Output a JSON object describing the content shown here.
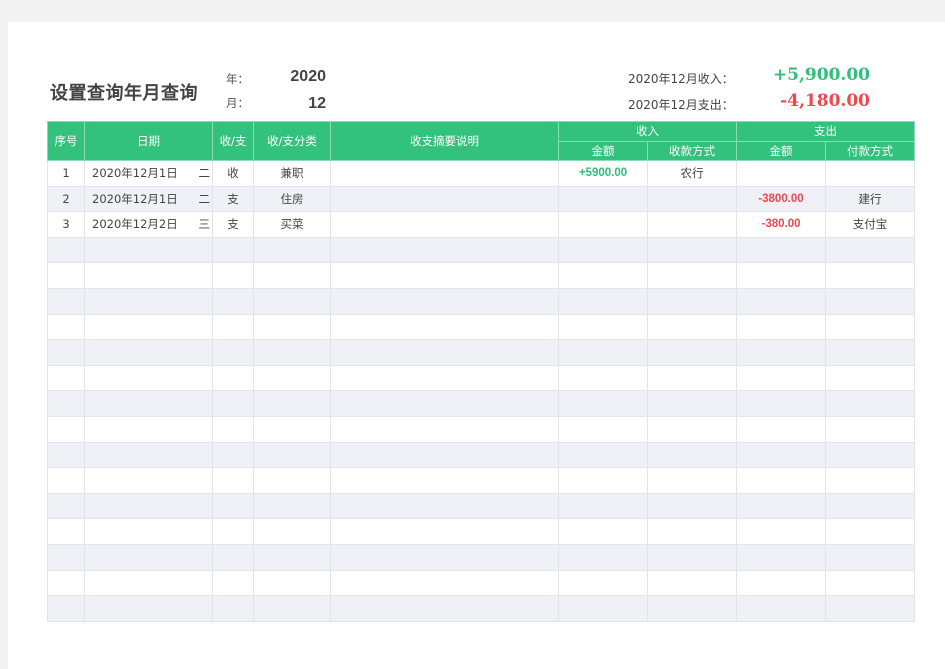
{
  "header": {
    "title": "设置查询年月查询",
    "year_label": "年：",
    "year_value": "2020",
    "month_label": "月：",
    "month_value": "12",
    "income_label": "2020年12月收入：",
    "income_value": "+5,900.00",
    "expense_label": "2020年12月支出：",
    "expense_value": "-4,180.00"
  },
  "colors": {
    "header_green": "#33c17e",
    "income_green": "#2fbf7a",
    "expense_red": "#f0474f"
  },
  "table": {
    "headers": {
      "seq": "序号",
      "date": "日期",
      "type": "收/支",
      "category": "收/支分类",
      "desc": "收支摘要说明",
      "income": "收入",
      "expense": "支出",
      "income_amount": "金额",
      "income_method": "收款方式",
      "expense_amount": "金额",
      "expense_method": "付款方式"
    },
    "rows": [
      {
        "seq": "1",
        "date": "2020年12月1日",
        "weekday": "二",
        "type": "收",
        "category": "兼职",
        "desc": "",
        "income_amount": "+5900.00",
        "income_method": "农行",
        "expense_amount": "",
        "expense_method": ""
      },
      {
        "seq": "2",
        "date": "2020年12月1日",
        "weekday": "二",
        "type": "支",
        "category": "住房",
        "desc": "",
        "income_amount": "",
        "income_method": "",
        "expense_amount": "-3800.00",
        "expense_method": "建行"
      },
      {
        "seq": "3",
        "date": "2020年12月2日",
        "weekday": "三",
        "type": "支",
        "category": "买菜",
        "desc": "",
        "income_amount": "",
        "income_method": "",
        "expense_amount": "-380.00",
        "expense_method": "支付宝"
      }
    ],
    "empty_rows": 15
  }
}
